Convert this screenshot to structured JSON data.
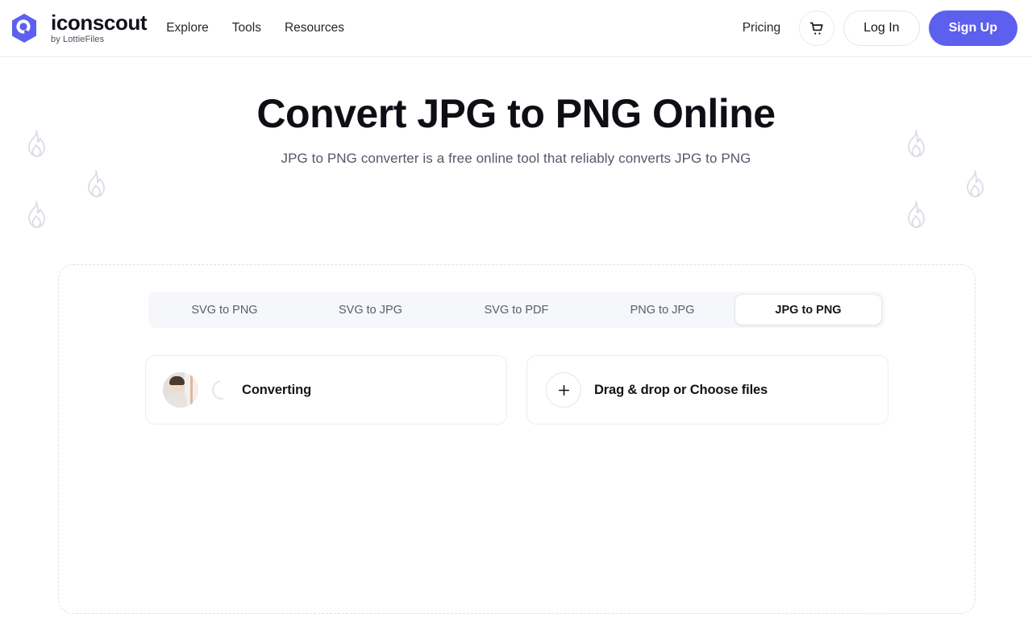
{
  "header": {
    "logo": {
      "icon": "iconscout-hexagon-logo-icon",
      "name": "iconscout",
      "tagline": "by LottieFiles"
    },
    "nav_links": [
      {
        "label": "Explore"
      },
      {
        "label": "Tools"
      },
      {
        "label": "Resources"
      }
    ],
    "pricing_label": "Pricing",
    "cart_icon": "shopping-cart-icon",
    "login_label": "Log In",
    "signup_label": "Sign Up"
  },
  "hero": {
    "title": "Convert JPG to PNG Online",
    "subtitle": "JPG to PNG converter is a free online tool that reliably converts JPG to PNG"
  },
  "decor": {
    "icon": "flame-icon",
    "color": "#d9dce6"
  },
  "converter": {
    "tabs": [
      {
        "label": "SVG to PNG",
        "active": false
      },
      {
        "label": "SVG to JPG",
        "active": false
      },
      {
        "label": "SVG to PDF",
        "active": false
      },
      {
        "label": "PNG to JPG",
        "active": false
      },
      {
        "label": "JPG to PNG",
        "active": true
      }
    ],
    "file_item": {
      "thumbnail_icon": "image-thumbnail-portrait",
      "status_icon": "loading-spinner-icon",
      "status_label": "Converting"
    },
    "dropzone": {
      "plus_icon": "plus-icon",
      "label": "Drag & drop or Choose files"
    }
  },
  "colors": {
    "brand_purple": "#5d5fef",
    "text_dark": "#15171d",
    "text_muted": "#585d72",
    "panel_border": "#dfe2eb",
    "tabs_bg": "#f6f7fa"
  }
}
